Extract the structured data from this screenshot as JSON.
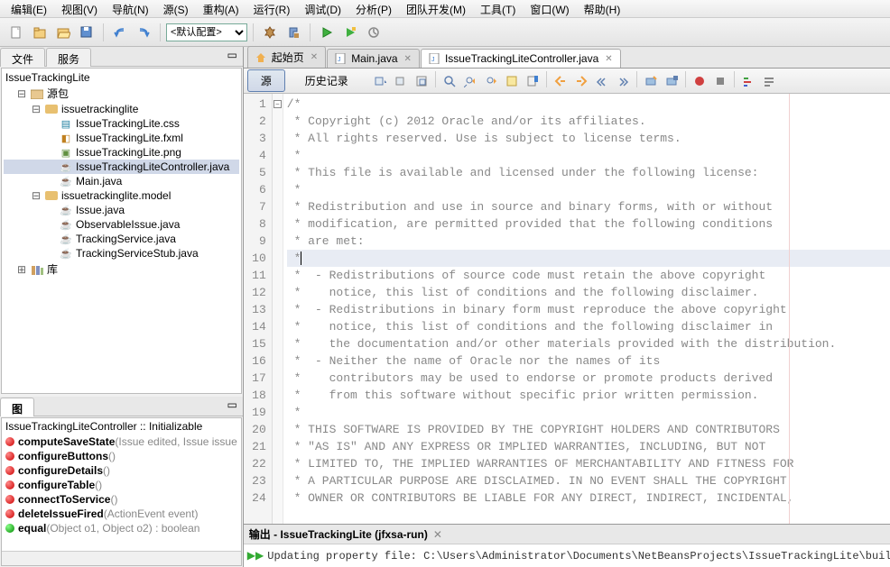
{
  "menu": [
    "编辑(E)",
    "视图(V)",
    "导航(N)",
    "源(S)",
    "重构(A)",
    "运行(R)",
    "调试(D)",
    "分析(P)",
    "团队开发(M)",
    "工具(T)",
    "窗口(W)",
    "帮助(H)"
  ],
  "toolbar": {
    "config_label": "<默认配置>"
  },
  "left": {
    "tabs": [
      "文件",
      "服务"
    ],
    "project_pane_title": "源包",
    "tree": {
      "root": "IssueTrackingLite",
      "pkg1": "issuetrackinglite",
      "pkg1_files": [
        "IssueTrackingLite.css",
        "IssueTrackingLite.fxml",
        "IssueTrackingLite.png",
        "IssueTrackingLiteController.java",
        "Main.java"
      ],
      "pkg2": "issuetrackinglite.model",
      "pkg2_files": [
        "Issue.java",
        "ObservableIssue.java",
        "TrackingService.java",
        "TrackingServiceStub.java"
      ],
      "lib": "库"
    },
    "nav_tab": "图",
    "nav_title": "IssueTrackingLiteController :: Initializable",
    "nav_items": [
      {
        "c": "red",
        "name": "computeSaveState",
        "sig": "(Issue edited, Issue issue"
      },
      {
        "c": "red",
        "name": "configureButtons",
        "sig": "()"
      },
      {
        "c": "red",
        "name": "configureDetails",
        "sig": "()"
      },
      {
        "c": "red",
        "name": "configureTable",
        "sig": "()"
      },
      {
        "c": "red",
        "name": "connectToService",
        "sig": "()"
      },
      {
        "c": "red",
        "name": "deleteIssueFired",
        "sig": "(ActionEvent event)"
      },
      {
        "c": "green",
        "name": "equal",
        "sig": "(Object o1, Object o2) : boolean"
      }
    ]
  },
  "editor": {
    "tabs": [
      {
        "label": "起始页",
        "icon": "home",
        "active": false,
        "closable": true
      },
      {
        "label": "Main.java",
        "icon": "java",
        "active": false,
        "closable": true
      },
      {
        "label": "IssueTrackingLiteController.java",
        "icon": "java",
        "active": true,
        "closable": true
      }
    ],
    "src_btn": "源",
    "history_btn": "历史记录",
    "lines": [
      "/*",
      " * Copyright (c) 2012 Oracle and/or its affiliates.",
      " * All rights reserved. Use is subject to license terms.",
      " * ",
      " * This file is available and licensed under the following license:",
      " * ",
      " * Redistribution and use in source and binary forms, with or without",
      " * modification, are permitted provided that the following conditions",
      " * are met:",
      " *",
      " *  - Redistributions of source code must retain the above copyright",
      " *    notice, this list of conditions and the following disclaimer.",
      " *  - Redistributions in binary form must reproduce the above copyright",
      " *    notice, this list of conditions and the following disclaimer in",
      " *    the documentation and/or other materials provided with the distribution.",
      " *  - Neither the name of Oracle nor the names of its",
      " *    contributors may be used to endorse or promote products derived",
      " *    from this software without specific prior written permission.",
      " * ",
      " * THIS SOFTWARE IS PROVIDED BY THE COPYRIGHT HOLDERS AND CONTRIBUTORS",
      " * \"AS IS\" AND ANY EXPRESS OR IMPLIED WARRANTIES, INCLUDING, BUT NOT",
      " * LIMITED TO, THE IMPLIED WARRANTIES OF MERCHANTABILITY AND FITNESS FOR",
      " * A PARTICULAR PURPOSE ARE DISCLAIMED. IN NO EVENT SHALL THE COPYRIGHT",
      " * OWNER OR CONTRIBUTORS BE LIABLE FOR ANY DIRECT, INDIRECT, INCIDENTAL,"
    ],
    "highlight_line_index": 9
  },
  "output": {
    "title": "输出 - IssueTrackingLite (jfxsa-run)",
    "text": "Updating property file: C:\\Users\\Administrator\\Documents\\NetBeansProjects\\IssueTrackingLite\\build\\built-jar.prop"
  }
}
